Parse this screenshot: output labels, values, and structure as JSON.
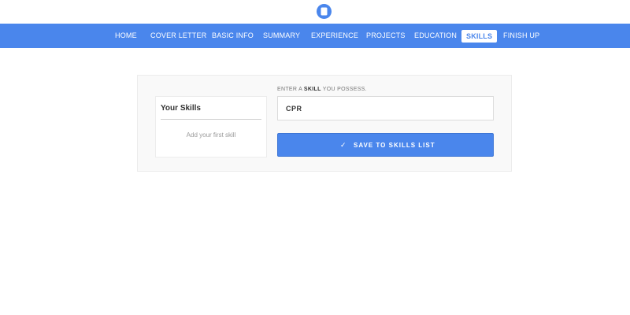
{
  "header": {
    "logo_icon": "document-icon"
  },
  "nav": {
    "items": [
      {
        "label": "HOME"
      },
      {
        "label": "COVER LETTER"
      },
      {
        "label": "BASIC INFO"
      },
      {
        "label": "SUMMARY"
      },
      {
        "label": "EXPERIENCE"
      },
      {
        "label": "PROJECTS"
      },
      {
        "label": "EDUCATION"
      },
      {
        "label": "SKILLS"
      },
      {
        "label": "FINISH UP"
      }
    ],
    "active": "SKILLS"
  },
  "skills_card": {
    "title": "Your Skills",
    "empty_text": "Add your first skill"
  },
  "form": {
    "label_prefix": "ENTER A",
    "label_emphasis": "SKILL",
    "label_suffix": "YOU POSSESS.",
    "input_value": "CPR",
    "save_icon": "check-icon",
    "save_label": "SAVE TO SKILLS LIST"
  },
  "colors": {
    "accent": "#4a86ec",
    "background": "#ffffff",
    "panel": "#f9f9f9"
  }
}
